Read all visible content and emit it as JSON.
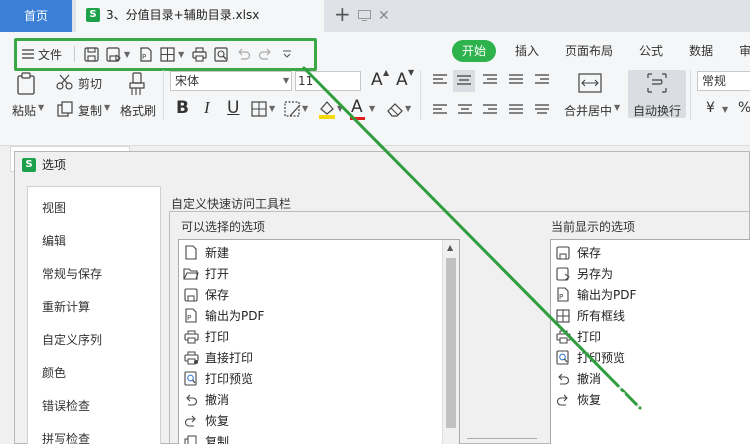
{
  "tabs": {
    "home_label": "首页",
    "doc_title": "3、分值目录+辅助目录.xlsx",
    "app_badge": "S"
  },
  "qat": {
    "menu_label": "文件"
  },
  "ribbon_tabs": [
    "开始",
    "插入",
    "页面布局",
    "公式",
    "数据",
    "审"
  ],
  "tools": {
    "paste": "粘贴",
    "cut": "剪切",
    "copy": "复制",
    "format_painter": "格式刷",
    "font_name": "宋体",
    "font_size": "11",
    "grow_font": "A",
    "shrink_font": "A",
    "bold": "B",
    "italic": "I",
    "underline": "U",
    "font_color_letter": "A",
    "merge_center": "合并居中",
    "wrap_text": "自动换行",
    "number_format": "常规",
    "currency": "¥",
    "percent": "%"
  },
  "colors": {
    "accent_green": "#2eb24b",
    "home_blue": "#3c7fd7",
    "highlight_green": "#3aa845",
    "font_color_red": "#e02020",
    "fill_yellow": "#f5d90a"
  },
  "dialog": {
    "title": "选项",
    "nav": [
      "视图",
      "编辑",
      "常规与保存",
      "重新计算",
      "自定义序列",
      "颜色",
      "错误检查",
      "拼写检查"
    ],
    "group_title": "自定义快速访问工具栏",
    "available_title": "可以选择的选项",
    "current_title": "当前显示的选项",
    "available": [
      {
        "label": "新建",
        "icon": "new-file-icon"
      },
      {
        "label": "打开",
        "icon": "folder-open-icon"
      },
      {
        "label": "保存",
        "icon": "save-icon"
      },
      {
        "label": "输出为PDF",
        "icon": "pdf-icon"
      },
      {
        "label": "打印",
        "icon": "print-icon"
      },
      {
        "label": "直接打印",
        "icon": "direct-print-icon"
      },
      {
        "label": "打印预览",
        "icon": "print-preview-icon"
      },
      {
        "label": "撤消",
        "icon": "undo-icon"
      },
      {
        "label": "恢复",
        "icon": "redo-icon"
      },
      {
        "label": "复制",
        "icon": "copy-icon"
      }
    ],
    "current": [
      {
        "label": "保存",
        "icon": "save-icon"
      },
      {
        "label": "另存为",
        "icon": "save-as-icon"
      },
      {
        "label": "输出为PDF",
        "icon": "pdf-icon"
      },
      {
        "label": "所有框线",
        "icon": "borders-icon"
      },
      {
        "label": "打印",
        "icon": "print-icon"
      },
      {
        "label": "打印预览",
        "icon": "print-preview-icon"
      },
      {
        "label": "撤消",
        "icon": "undo-icon"
      },
      {
        "label": "恢复",
        "icon": "redo-icon"
      }
    ]
  }
}
